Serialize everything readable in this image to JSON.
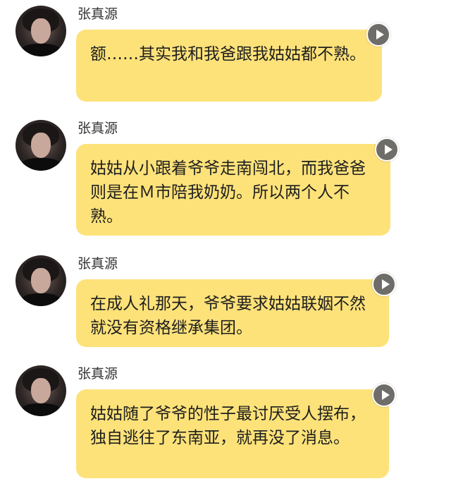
{
  "messages": [
    {
      "sender": "张真源",
      "text": "额……其实我和我爸跟我姑姑都不熟。",
      "avatar_icon": "user-avatar",
      "play_icon": "play-icon"
    },
    {
      "sender": "张真源",
      "text": "姑姑从小跟着爷爷走南闯北，而我爸爸则是在Ｍ市陪我奶奶。所以两个人不熟。",
      "avatar_icon": "user-avatar",
      "play_icon": "play-icon"
    },
    {
      "sender": "张真源",
      "text": "在成人礼那天，爷爷要求姑姑联姻不然就没有资格继承集团。",
      "avatar_icon": "user-avatar",
      "play_icon": "play-icon"
    },
    {
      "sender": "张真源",
      "text": "姑姑随了爷爷的性子最讨厌受人摆布，独自逃往了东南亚，就再没了消息。",
      "avatar_icon": "user-avatar",
      "play_icon": "play-icon"
    }
  ],
  "colors": {
    "bubble": "#fde27a",
    "background": "#ffffff",
    "play_button": "#6f6d69"
  }
}
